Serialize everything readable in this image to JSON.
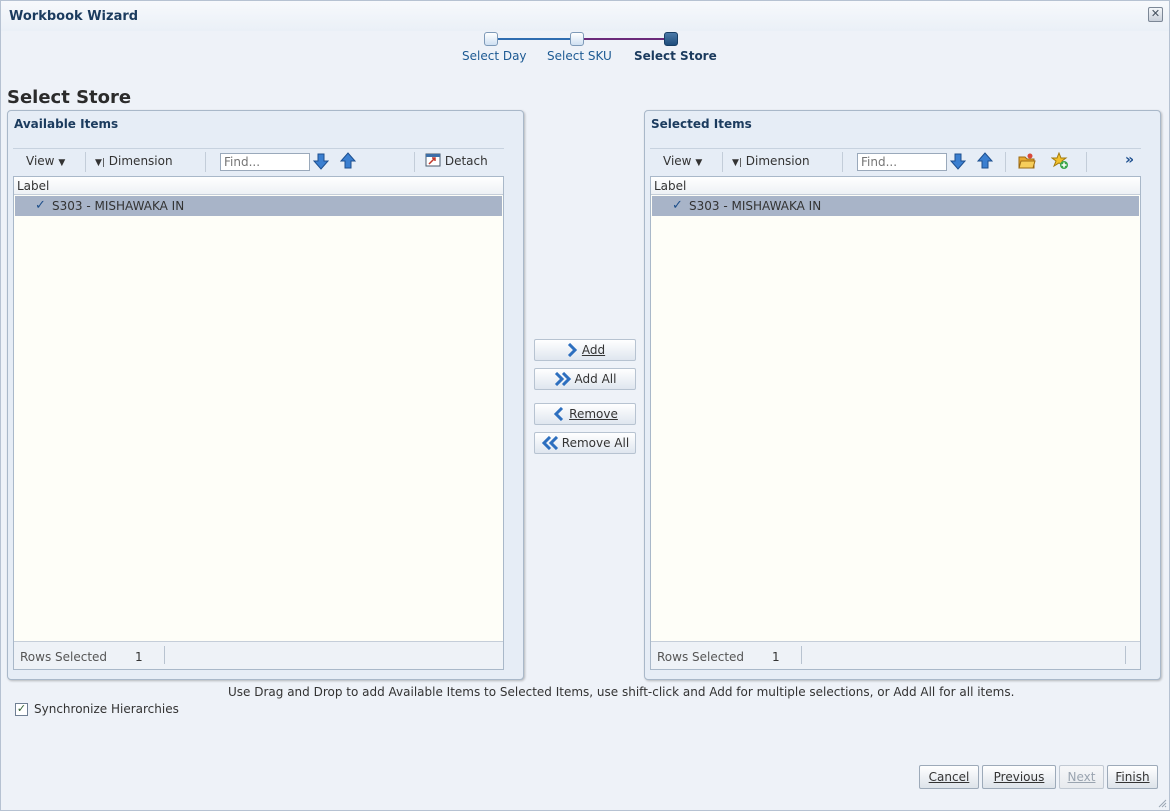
{
  "window": {
    "title": "Workbook Wizard",
    "close_glyph": "✕"
  },
  "train": {
    "steps": [
      {
        "label": "Select Day",
        "state": "visited"
      },
      {
        "label": "Select SKU",
        "state": "visited"
      },
      {
        "label": "Select Store",
        "state": "current"
      }
    ]
  },
  "page": {
    "title": "Select Store"
  },
  "available": {
    "title": "Available Items",
    "toolbar": {
      "view": "View",
      "dimension": "Dimension",
      "find_placeholder": "Find...",
      "detach": "Detach"
    },
    "column": "Label",
    "rows": [
      {
        "label": "S303 - MISHAWAKA IN",
        "selected": true
      }
    ],
    "footer": {
      "label": "Rows Selected",
      "value": "1"
    }
  },
  "selected": {
    "title": "Selected Items",
    "toolbar": {
      "view": "View",
      "dimension": "Dimension",
      "find_placeholder": "Find...",
      "more": "»"
    },
    "column": "Label",
    "rows": [
      {
        "label": "S303 - MISHAWAKA IN",
        "selected": true
      }
    ],
    "footer": {
      "label": "Rows Selected",
      "value": "1"
    }
  },
  "shuttle": {
    "add": "Add",
    "add_all": "Add All",
    "remove": "Remove",
    "remove_all": "Remove All"
  },
  "instructions": "Use Drag and Drop to add Available Items to Selected Items, use shift-click and Add for multiple selections, or Add All for all items.",
  "sync": {
    "label": "Synchronize Hierarchies",
    "checked": true
  },
  "nav": {
    "cancel": "Cancel",
    "previous": "Previous",
    "next": "Next",
    "finish": "Finish"
  },
  "colors": {
    "accent": "#1b3b5e",
    "train_line": "#2f6db0",
    "train_line_current": "#6b2a7a",
    "row_selected": "#a8b4c8"
  }
}
